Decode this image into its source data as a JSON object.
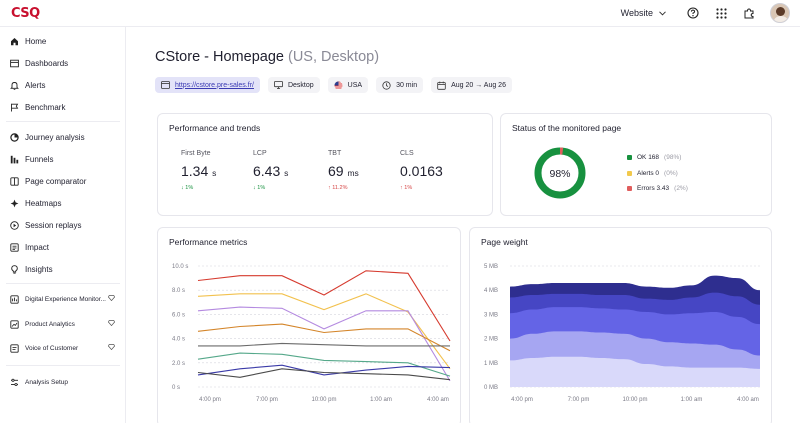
{
  "app": {
    "logo": "CSQ"
  },
  "topbar": {
    "scope_label": "Website"
  },
  "sidebar": {
    "items": [
      {
        "label": "Home",
        "icon": "home-icon"
      },
      {
        "label": "Dashboards",
        "icon": "dashboard-icon"
      },
      {
        "label": "Alerts",
        "icon": "bell-icon"
      },
      {
        "label": "Benchmark",
        "icon": "benchmark-icon"
      },
      {
        "label": "Journey analysis",
        "icon": "journey-icon"
      },
      {
        "label": "Funnels",
        "icon": "funnel-icon"
      },
      {
        "label": "Page comparator",
        "icon": "comparator-icon"
      },
      {
        "label": "Heatmaps",
        "icon": "heatmap-icon"
      },
      {
        "label": "Session replays",
        "icon": "replay-icon"
      },
      {
        "label": "Impact",
        "icon": "impact-icon"
      },
      {
        "label": "Insights",
        "icon": "lightbulb-icon"
      },
      {
        "label": "Digital Experience Monitor...",
        "icon": "monitor-icon"
      },
      {
        "label": "Product Analytics",
        "icon": "analytics-icon"
      },
      {
        "label": "Voice of Customer",
        "icon": "voice-icon"
      },
      {
        "label": "Analysis Setup",
        "icon": "settings-icon"
      }
    ]
  },
  "page": {
    "title": "CStore - Homepage",
    "title_sub": "(US, Desktop)",
    "chips": [
      {
        "label": "https://cstore.pre-sales.fr/",
        "icon": "browser-icon"
      },
      {
        "label": "Desktop",
        "icon": "desktop-icon"
      },
      {
        "label": "USA",
        "icon": "us-flag-icon"
      },
      {
        "label": "30 min",
        "icon": "clock-icon"
      },
      {
        "label": "Aug 20 → Aug 26",
        "icon": "calendar-icon"
      }
    ]
  },
  "performance": {
    "title": "Performance and trends",
    "metrics": [
      {
        "label": "First Byte",
        "value": "1.34",
        "unit": "s",
        "change": "1%",
        "direction": "down"
      },
      {
        "label": "LCP",
        "value": "6.43",
        "unit": "s",
        "change": "1%",
        "direction": "down"
      },
      {
        "label": "TBT",
        "value": "69",
        "unit": "ms",
        "change": "11.2%",
        "direction": "up"
      },
      {
        "label": "CLS",
        "value": "0.0163",
        "unit": "",
        "change": "1%",
        "direction": "up"
      }
    ]
  },
  "status": {
    "title": "Status of the monitored page",
    "center_label": "98%",
    "legend": [
      {
        "label": "OK 168",
        "pct": "(98%)",
        "color": "#17913f"
      },
      {
        "label": "Alerts 0",
        "pct": "(0%)",
        "color": "#f2c94c"
      },
      {
        "label": "Errors 3.43",
        "pct": "(2%)",
        "color": "#e05d5d"
      }
    ],
    "ok_fraction": 0.98,
    "error_fraction": 0.02
  },
  "chart_data": [
    {
      "type": "line",
      "title": "Performance metrics",
      "x": [
        "4:00 pm",
        "7:00 pm",
        "10:00 pm",
        "1:00 am",
        "4:00 am"
      ],
      "y_ticks": [
        "10.0 s",
        "8.0 s",
        "6.0 s",
        "4.0 s",
        "2.0 s",
        "0 s"
      ],
      "ylim": [
        0,
        10
      ],
      "series": [
        {
          "color": "#d63b2f",
          "values": [
            8.8,
            9.2,
            9.2,
            7.6,
            9.6,
            9.4,
            3.8
          ]
        },
        {
          "color": "#f2c14e",
          "values": [
            7.5,
            7.7,
            7.7,
            6.4,
            7.7,
            6.2,
            1.5
          ]
        },
        {
          "color": "#b48ae0",
          "values": [
            6.3,
            6.6,
            6.5,
            4.8,
            6.3,
            6.3,
            0.5
          ]
        },
        {
          "color": "#d4852a",
          "values": [
            4.6,
            5.0,
            5.2,
            4.5,
            4.8,
            4.8,
            3.0
          ]
        },
        {
          "color": "#6b6b6b",
          "values": [
            3.4,
            3.4,
            3.6,
            3.5,
            3.4,
            3.4,
            3.4
          ]
        },
        {
          "color": "#55a88a",
          "values": [
            2.3,
            2.8,
            2.7,
            2.2,
            2.1,
            2.0,
            0.9
          ]
        },
        {
          "color": "#3a3aa8",
          "values": [
            1.0,
            1.5,
            1.8,
            1.0,
            1.4,
            1.7,
            1.6
          ]
        },
        {
          "color": "#4a4a4a",
          "values": [
            1.2,
            0.8,
            1.5,
            1.2,
            1.1,
            1.0,
            0.6
          ]
        }
      ]
    },
    {
      "type": "area",
      "title": "Page weight",
      "x": [
        "4:00 pm",
        "7:00 pm",
        "10:00 pm",
        "1:00 am",
        "4:00 am"
      ],
      "y_ticks": [
        "5 MB",
        "4 MB",
        "3 MB",
        "2 MB",
        "1 MB",
        "0 MB"
      ],
      "ylim": [
        0,
        5
      ],
      "series": [
        {
          "color": "#2e2e8f",
          "values": [
            4.15,
            4.25,
            4.3,
            4.3,
            4.3,
            4.3,
            4.15,
            4.1,
            4.2,
            4.6,
            4.5,
            4.0
          ]
        },
        {
          "color": "#4646c4",
          "values": [
            3.7,
            3.8,
            3.85,
            3.85,
            3.8,
            3.8,
            3.65,
            3.6,
            3.7,
            3.9,
            3.75,
            3.4
          ]
        },
        {
          "color": "#6464e6",
          "values": [
            3.05,
            3.2,
            3.3,
            3.3,
            3.25,
            3.2,
            3.1,
            3.0,
            3.05,
            3.1,
            2.9,
            2.6
          ]
        },
        {
          "color": "#a6a6f2",
          "values": [
            2.0,
            2.2,
            2.3,
            2.3,
            2.25,
            2.2,
            2.0,
            1.85,
            1.8,
            1.75,
            1.55,
            1.3
          ]
        },
        {
          "color": "#d9d9fa",
          "values": [
            1.1,
            1.2,
            1.25,
            1.25,
            1.2,
            1.15,
            0.95,
            0.85,
            0.8,
            0.8,
            0.8,
            0.75
          ]
        }
      ]
    }
  ]
}
